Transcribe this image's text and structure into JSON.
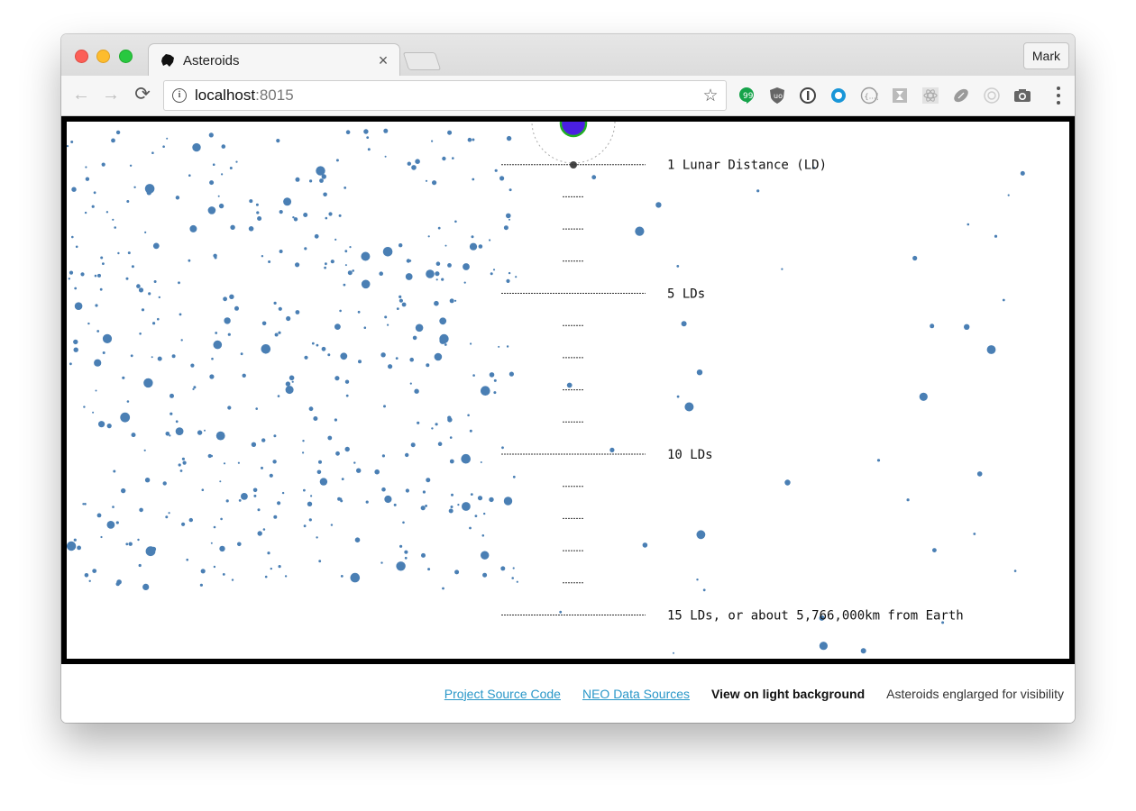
{
  "browser": {
    "tab_title": "Asteroids",
    "tab_close": "×",
    "profile_name": "Mark",
    "url_host": "localhost",
    "url_port": ":8015",
    "star": "☆",
    "nav": {
      "back": "←",
      "forward": "→",
      "reload": "⟳"
    },
    "extension_icons": [
      "hangouts-icon",
      "ublock-icon",
      "onepassword-icon",
      "circle-blue-icon",
      "braces-icon",
      "hourglass-icon",
      "react-icon",
      "football-icon",
      "target-icon",
      "camera-icon"
    ]
  },
  "visualization": {
    "scale_labels": [
      "1 Lunar Distance (LD)",
      "5 LDs",
      "10 LDs",
      "15 LDs, or about 5,766,000km from Earth"
    ],
    "lunar_distance_km": 384400,
    "max_ld": 15,
    "colors": {
      "asteroid": "#4a7fb4",
      "earth_fill": "#4a1fe0",
      "earth_stroke": "#22b022",
      "frame": "#000000"
    }
  },
  "footer": {
    "source_code": "Project Source Code",
    "data_sources": "NEO Data Sources",
    "light_background": "View on light background",
    "note": "Asteroids englarged for visibility"
  }
}
